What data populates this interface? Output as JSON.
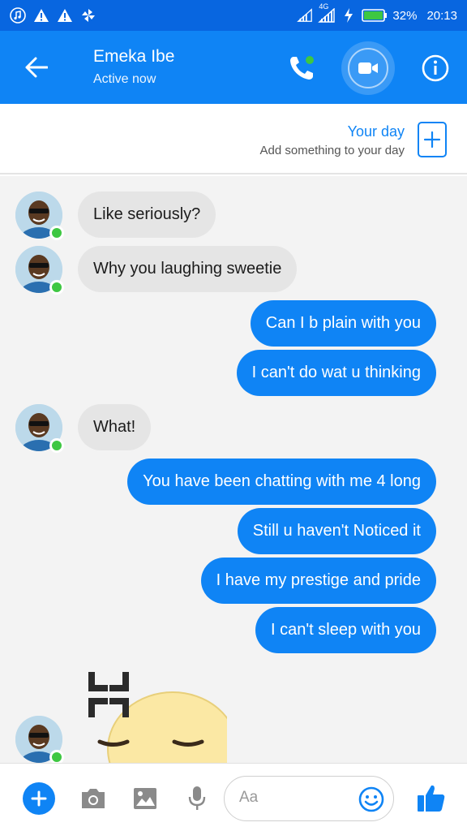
{
  "status_bar": {
    "network": "4G",
    "battery": "32%",
    "time": "20:13",
    "icons": [
      "music-icon",
      "warning-icon",
      "warning-icon",
      "pinwheel-icon",
      "signal-icon",
      "lightning-icon",
      "battery-icon"
    ]
  },
  "header": {
    "name": "Emeka Ibe",
    "status": "Active now",
    "icons": [
      "back-arrow-icon",
      "phone-icon",
      "video-camera-icon",
      "info-icon"
    ]
  },
  "your_day": {
    "title": "Your day",
    "subtitle": "Add something to your day"
  },
  "messages": [
    {
      "direction": "in",
      "text": "Like seriously?"
    },
    {
      "direction": "in",
      "text": "Why you laughing sweetie"
    },
    {
      "direction": "out",
      "text": "Can I b plain with you"
    },
    {
      "direction": "out",
      "text": "I can't do wat u thinking"
    },
    {
      "direction": "in",
      "text": "What!"
    },
    {
      "direction": "out",
      "text": "You have been chatting with me 4 long"
    },
    {
      "direction": "out",
      "text": "Still u haven't Noticed it"
    },
    {
      "direction": "out",
      "text": "I have my prestige and pride"
    },
    {
      "direction": "out",
      "text": "I can't sleep with you"
    },
    {
      "direction": "in",
      "emoji": "angry-face-emoji"
    }
  ],
  "composer": {
    "placeholder": "Aa",
    "icons": [
      "plus-icon",
      "camera-icon",
      "image-icon",
      "microphone-icon",
      "smiley-icon",
      "thumbs-up-icon"
    ]
  },
  "colors": {
    "status_bar": "#0866e0",
    "header": "#0f84f5",
    "accent": "#0f84f5",
    "incoming_bubble": "#e5e5e5",
    "chat_bg": "#f3f3f3",
    "online": "#3ec742"
  }
}
